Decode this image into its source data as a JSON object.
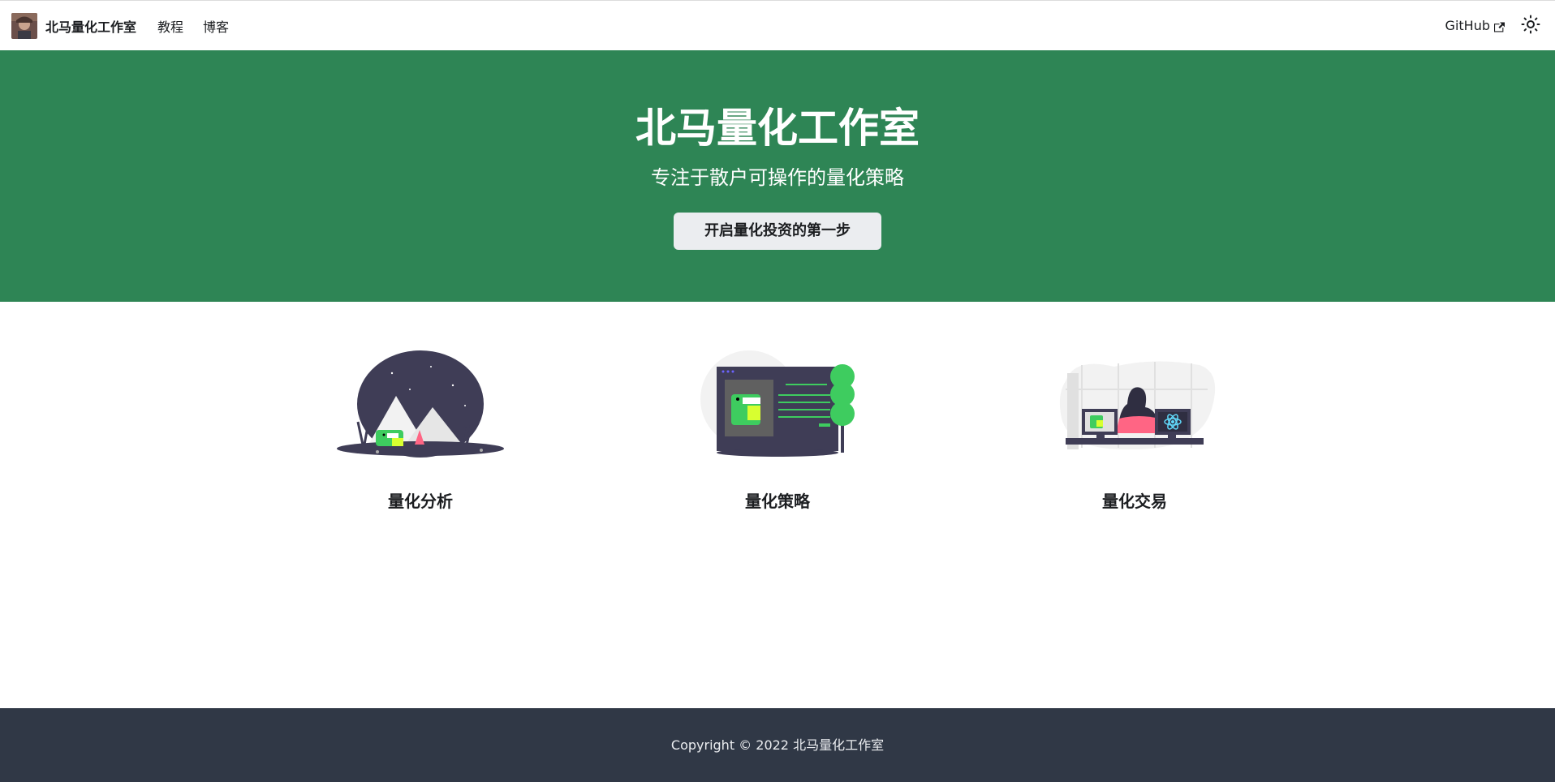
{
  "navbar": {
    "brand_title": "北马量化工作室",
    "links": [
      {
        "label": "教程"
      },
      {
        "label": "博客"
      }
    ],
    "github_label": "GitHub",
    "icons": {
      "external": "external-link-icon",
      "theme": "sun-icon"
    }
  },
  "hero": {
    "title": "北马量化工作室",
    "subtitle": "专注于散户可操作的量化策略",
    "button_label": "开启量化投资的第一步",
    "background": "#2e8555"
  },
  "features": [
    {
      "title": "量化分析",
      "illustration": "mountain-illustration"
    },
    {
      "title": "量化策略",
      "illustration": "monitor-tree-illustration"
    },
    {
      "title": "量化交易",
      "illustration": "desk-person-illustration"
    }
  ],
  "footer": {
    "copyright": "Copyright © 2022 北马量化工作室",
    "background": "#303846"
  },
  "colors": {
    "primary": "#2e8555",
    "dino_green": "#3ecc5f",
    "dark_purple": "#3f3d56"
  }
}
